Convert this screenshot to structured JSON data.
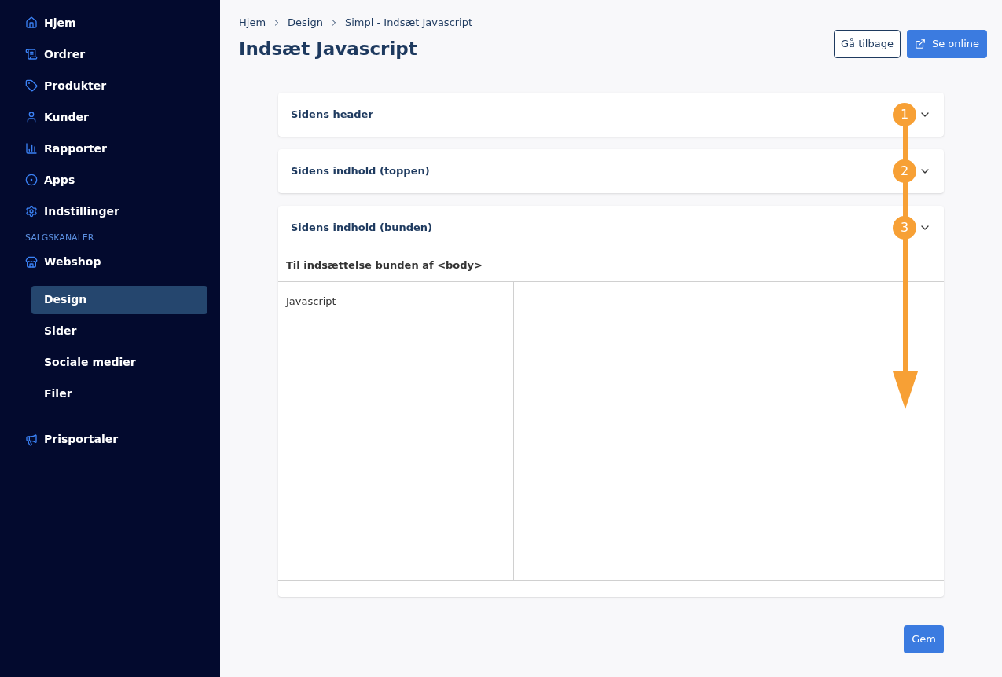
{
  "sidebar": {
    "nav_items": [
      {
        "label": "Hjem"
      },
      {
        "label": "Ordrer"
      },
      {
        "label": "Produkter"
      },
      {
        "label": "Kunder"
      },
      {
        "label": "Rapporter"
      },
      {
        "label": "Apps"
      },
      {
        "label": "Indstillinger"
      }
    ],
    "section_heading": "SALGSKANALER",
    "channel": {
      "label": "Webshop",
      "children": [
        {
          "label": "Design",
          "selected": true
        },
        {
          "label": "Sider",
          "selected": false
        },
        {
          "label": "Sociale medier",
          "selected": false
        },
        {
          "label": "Filer",
          "selected": false
        }
      ]
    },
    "extra_items": [
      {
        "label": "Prisportaler"
      }
    ]
  },
  "breadcrumb": [
    {
      "label": "Hjem",
      "link": true
    },
    {
      "label": "Design",
      "link": true
    },
    {
      "label": "Simpl - Indsæt Javascript",
      "link": false
    }
  ],
  "page_title": "Indsæt Javascript",
  "header_buttons": [
    {
      "label": "Gå tilbage",
      "kind": "outline"
    },
    {
      "label": "Se online",
      "kind": "primary"
    }
  ],
  "sections": [
    {
      "title": "Sidens header",
      "expanded": false
    },
    {
      "title": "Sidens indhold (toppen)",
      "expanded": false
    },
    {
      "title": "Sidens indhold (bunden)",
      "expanded": true,
      "subtitle": "Til indsættelse bunden af <body>",
      "field_label": "Javascript"
    }
  ],
  "annotation": {
    "markers": [
      "1",
      "2",
      "3"
    ]
  },
  "save_button": "Gem"
}
